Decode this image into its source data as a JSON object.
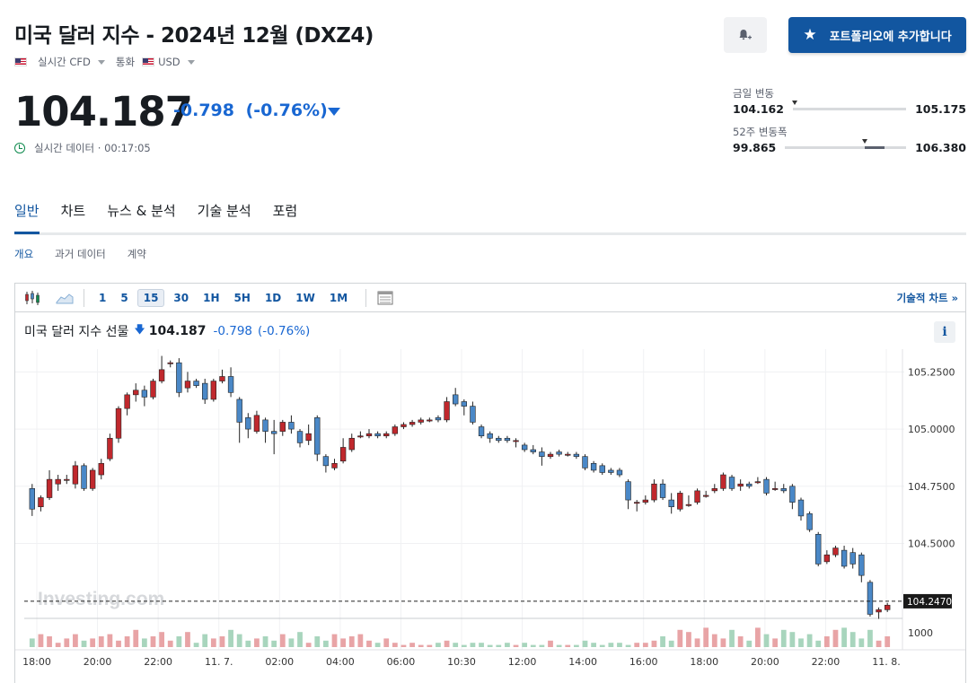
{
  "header": {
    "title": "미국 달러 지수 - 2024년 12월 (DXZ4)",
    "market_label": "실시간 CFD",
    "currency_label": "통화",
    "currency_value": "USD",
    "bell_icon": "bell-plus-icon",
    "portfolio_label": "포트폴리오에 추가합니다"
  },
  "quote": {
    "price": "104.187",
    "change": "-0.798",
    "change_pct": "(-0.76%)",
    "realtime_label": "실시간 데이터 · 00:17:05"
  },
  "ranges": {
    "day": {
      "label": "금일 변동",
      "low": "104.162",
      "high": "105.175",
      "marker": 0.02
    },
    "week52": {
      "label": "52주 변동폭",
      "low": "99.865",
      "high": "106.380",
      "marker": 0.66,
      "fill_start": 0.66,
      "fill_end": 0.82
    }
  },
  "tabs": [
    "일반",
    "차트",
    "뉴스 & 분석",
    "기술 분석",
    "포럼"
  ],
  "subtabs": [
    "개요",
    "과거 데이터",
    "계약"
  ],
  "toolbar": {
    "intervals": [
      "1",
      "5",
      "15",
      "30",
      "1H",
      "5H",
      "1D",
      "1W",
      "1M"
    ],
    "active_interval": "15",
    "tech_chart_label": "기술적 차트 »"
  },
  "chart_header": {
    "name": "미국 달러 지수 선물",
    "price": "104.187",
    "change": "-0.798",
    "change_pct": "(-0.76%)",
    "info": "i"
  },
  "colors": {
    "up": "#c0282d",
    "down": "#4a88c7",
    "accent": "#1256a0",
    "negative": "#1967d2"
  },
  "chart_data": {
    "type": "candlestick",
    "y_ticks": [
      "105.2500",
      "105.0000",
      "104.7500",
      "104.5000"
    ],
    "ylim": [
      104.18,
      105.33
    ],
    "last_price_label": "104.2470",
    "last_price": 104.247,
    "watermark": "Investing.com",
    "volume_tick": "1000",
    "x_ticks": [
      "18:00",
      "20:00",
      "22:00",
      "11. 7.",
      "02:00",
      "04:00",
      "06:00",
      "10:30",
      "12:00",
      "14:00",
      "16:00",
      "18:00",
      "20:00",
      "22:00",
      "11. 8."
    ],
    "candles": [
      [
        104.74,
        104.65,
        104.76,
        104.62
      ],
      [
        104.66,
        104.7,
        104.71,
        104.64
      ],
      [
        104.7,
        104.78,
        104.82,
        104.69
      ],
      [
        104.76,
        104.78,
        104.8,
        104.73
      ],
      [
        104.78,
        104.78,
        104.8,
        104.76
      ],
      [
        104.76,
        104.84,
        104.86,
        104.74
      ],
      [
        104.84,
        104.74,
        104.85,
        104.73
      ],
      [
        104.74,
        104.82,
        104.83,
        104.73
      ],
      [
        104.8,
        104.85,
        104.87,
        104.78
      ],
      [
        104.87,
        104.96,
        104.98,
        104.86
      ],
      [
        104.96,
        105.09,
        105.1,
        104.94
      ],
      [
        105.09,
        105.15,
        105.16,
        105.06
      ],
      [
        105.15,
        105.17,
        105.2,
        105.12
      ],
      [
        105.17,
        105.14,
        105.19,
        105.1
      ],
      [
        105.14,
        105.21,
        105.22,
        105.13
      ],
      [
        105.21,
        105.26,
        105.32,
        105.2
      ],
      [
        105.29,
        105.29,
        105.3,
        105.27
      ],
      [
        105.29,
        105.16,
        105.31,
        105.14
      ],
      [
        105.18,
        105.21,
        105.25,
        105.16
      ],
      [
        105.21,
        105.19,
        105.22,
        105.18
      ],
      [
        105.2,
        105.13,
        105.22,
        105.11
      ],
      [
        105.13,
        105.21,
        105.22,
        105.12
      ],
      [
        105.21,
        105.23,
        105.26,
        105.2
      ],
      [
        105.23,
        105.16,
        105.27,
        105.14
      ],
      [
        105.13,
        105.03,
        105.14,
        104.94
      ],
      [
        105.05,
        105.0,
        105.07,
        104.96
      ],
      [
        104.99,
        105.06,
        105.08,
        104.98
      ],
      [
        105.04,
        104.99,
        105.05,
        104.94
      ],
      [
        104.99,
        104.98,
        105.04,
        104.89
      ],
      [
        104.99,
        105.03,
        105.04,
        104.97
      ],
      [
        105.03,
        105.0,
        105.06,
        104.98
      ],
      [
        104.99,
        104.94,
        105.0,
        104.92
      ],
      [
        104.95,
        104.98,
        105.02,
        104.93
      ],
      [
        105.05,
        104.89,
        105.06,
        104.86
      ],
      [
        104.88,
        104.84,
        104.89,
        104.81
      ],
      [
        104.83,
        104.85,
        104.87,
        104.82
      ],
      [
        104.86,
        104.92,
        104.96,
        104.85
      ],
      [
        104.91,
        104.96,
        104.98,
        104.9
      ],
      [
        104.97,
        104.97,
        104.99,
        104.96
      ],
      [
        104.97,
        104.98,
        105.0,
        104.96
      ],
      [
        104.98,
        104.97,
        104.99,
        104.96
      ],
      [
        104.97,
        104.98,
        104.99,
        104.96
      ],
      [
        104.98,
        105.01,
        105.02,
        104.97
      ],
      [
        105.01,
        105.02,
        105.03,
        105.0
      ],
      [
        105.02,
        105.03,
        105.04,
        105.01
      ],
      [
        105.03,
        105.04,
        105.05,
        105.02
      ],
      [
        105.04,
        105.04,
        105.05,
        105.03
      ],
      [
        105.05,
        105.04,
        105.06,
        105.03
      ],
      [
        105.04,
        105.12,
        105.14,
        105.03
      ],
      [
        105.15,
        105.11,
        105.18,
        105.1
      ],
      [
        105.12,
        105.1,
        105.13,
        105.06
      ],
      [
        105.1,
        105.03,
        105.12,
        105.02
      ],
      [
        105.01,
        104.97,
        105.02,
        104.96
      ],
      [
        104.98,
        104.96,
        104.99,
        104.94
      ],
      [
        104.96,
        104.95,
        104.97,
        104.94
      ],
      [
        104.96,
        104.95,
        104.97,
        104.94
      ],
      [
        104.95,
        104.95,
        104.96,
        104.92
      ],
      [
        104.93,
        104.91,
        104.94,
        104.9
      ],
      [
        104.91,
        104.9,
        104.93,
        104.89
      ],
      [
        104.9,
        104.88,
        104.92,
        104.84
      ],
      [
        104.88,
        104.89,
        104.9,
        104.87
      ],
      [
        104.9,
        104.89,
        104.91,
        104.88
      ],
      [
        104.89,
        104.89,
        104.9,
        104.88
      ],
      [
        104.89,
        104.88,
        104.9,
        104.87
      ],
      [
        104.88,
        104.83,
        104.89,
        104.82
      ],
      [
        104.85,
        104.82,
        104.86,
        104.81
      ],
      [
        104.84,
        104.81,
        104.85,
        104.8
      ],
      [
        104.82,
        104.81,
        104.83,
        104.8
      ],
      [
        104.82,
        104.8,
        104.83,
        104.79
      ],
      [
        104.77,
        104.69,
        104.78,
        104.65
      ],
      [
        104.68,
        104.68,
        104.69,
        104.64
      ],
      [
        104.68,
        104.69,
        104.71,
        104.67
      ],
      [
        104.69,
        104.76,
        104.78,
        104.68
      ],
      [
        104.76,
        104.7,
        104.78,
        104.69
      ],
      [
        104.69,
        104.66,
        104.72,
        104.63
      ],
      [
        104.65,
        104.72,
        104.73,
        104.64
      ],
      [
        104.67,
        104.67,
        104.71,
        104.66
      ],
      [
        104.68,
        104.73,
        104.74,
        104.67
      ],
      [
        104.71,
        104.71,
        104.73,
        104.7
      ],
      [
        104.73,
        104.74,
        104.76,
        104.72
      ],
      [
        104.74,
        104.8,
        104.81,
        104.73
      ],
      [
        104.79,
        104.74,
        104.8,
        104.73
      ],
      [
        104.75,
        104.76,
        104.78,
        104.73
      ],
      [
        104.76,
        104.75,
        104.77,
        104.74
      ],
      [
        104.77,
        104.77,
        104.79,
        104.76
      ],
      [
        104.78,
        104.72,
        104.79,
        104.71
      ],
      [
        104.74,
        104.74,
        104.77,
        104.73
      ],
      [
        104.74,
        104.73,
        104.76,
        104.72
      ],
      [
        104.75,
        104.68,
        104.76,
        104.65
      ],
      [
        104.69,
        104.62,
        104.7,
        104.6
      ],
      [
        104.63,
        104.56,
        104.64,
        104.55
      ],
      [
        104.54,
        104.41,
        104.55,
        104.4
      ],
      [
        104.42,
        104.45,
        104.47,
        104.41
      ],
      [
        104.45,
        104.48,
        104.49,
        104.44
      ],
      [
        104.47,
        104.4,
        104.49,
        104.39
      ],
      [
        104.46,
        104.41,
        104.48,
        104.39
      ],
      [
        104.45,
        104.36,
        104.46,
        104.33
      ],
      [
        104.33,
        104.19,
        104.34,
        104.18
      ],
      [
        104.2,
        104.21,
        104.22,
        104.17
      ],
      [
        104.21,
        104.23,
        104.24,
        104.2
      ]
    ],
    "volumes": [
      4,
      6,
      5,
      2,
      4,
      6,
      3,
      4,
      5,
      6,
      3,
      5,
      8,
      4,
      5,
      7,
      3,
      5,
      7,
      2,
      6,
      4,
      5,
      8,
      6,
      3,
      4,
      5,
      3,
      6,
      4,
      7,
      2,
      5,
      3,
      6,
      4,
      5,
      6,
      3,
      2,
      4,
      2,
      1,
      2,
      1,
      1,
      2,
      3,
      2,
      1,
      2,
      2,
      1,
      1,
      2,
      1,
      2,
      1,
      1,
      3,
      1,
      1,
      1,
      3,
      2,
      1,
      2,
      2,
      1,
      2,
      2,
      3,
      5,
      3,
      8,
      7,
      4,
      9,
      6,
      4,
      8,
      5,
      3,
      9,
      6,
      4,
      8,
      7,
      4,
      6,
      3,
      5,
      8,
      9,
      7,
      4,
      8,
      3,
      5,
      2
    ]
  }
}
